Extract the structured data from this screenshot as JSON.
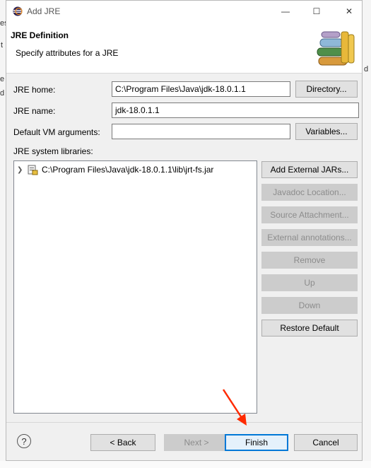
{
  "window": {
    "title": "Add JRE",
    "minimize_glyph": "—",
    "maximize_glyph": "☐",
    "close_glyph": "✕"
  },
  "header": {
    "title": "JRE Definition",
    "description": "Specify attributes for a JRE",
    "icon": "library-books-icon"
  },
  "form": {
    "jre_home": {
      "label": "JRE home:",
      "value": "C:\\Program Files\\Java\\jdk-18.0.1.1",
      "button": "Directory..."
    },
    "jre_name": {
      "label": "JRE name:",
      "value": "jdk-18.0.1.1"
    },
    "vm_args": {
      "label": "Default VM arguments:",
      "value": "",
      "button": "Variables..."
    }
  },
  "libraries": {
    "label": "JRE system libraries:",
    "items": [
      {
        "path": "C:\\Program Files\\Java\\jdk-18.0.1.1\\lib\\jrt-fs.jar",
        "icon": "jar-icon"
      }
    ],
    "buttons": {
      "add_external": "Add External JARs...",
      "javadoc": "Javadoc Location...",
      "source": "Source Attachment...",
      "external_annotations": "External annotations...",
      "remove": "Remove",
      "up": "Up",
      "down": "Down",
      "restore": "Restore Default"
    }
  },
  "footer": {
    "help_glyph": "?",
    "back": "< Back",
    "next": "Next >",
    "finish": "Finish",
    "cancel": "Cancel"
  },
  "background_fragments": {
    "left_1": "es",
    "left_2": "t",
    "left_3": "e",
    "left_4": "d",
    "right_1": "d"
  },
  "colors": {
    "accent": "#0078d7",
    "annotation_arrow": "#ff2a00"
  }
}
